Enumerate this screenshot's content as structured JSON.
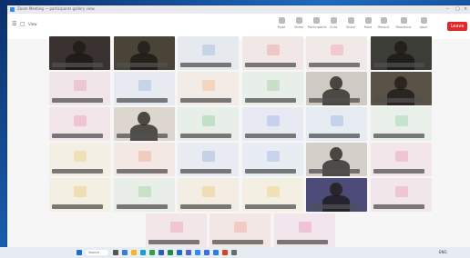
{
  "window": {
    "title": "Zoom Meeting — participants gallery view"
  },
  "toolbar": {
    "left_items": [
      "☰",
      "▢",
      "View"
    ],
    "tools": [
      {
        "label": "Mute",
        "icon": "mic-icon"
      },
      {
        "label": "Video",
        "icon": "camera-icon"
      },
      {
        "label": "Participants",
        "icon": "people-icon"
      },
      {
        "label": "Chat",
        "icon": "chat-icon"
      },
      {
        "label": "Share",
        "icon": "share-icon"
      },
      {
        "label": "More",
        "icon": "more-icon"
      }
    ],
    "right_tools": [
      {
        "label": "Record",
        "icon": "record-icon"
      },
      {
        "label": "Reactions",
        "icon": "reactions-icon"
      },
      {
        "label": "Apps",
        "icon": "apps-icon"
      }
    ],
    "leave_label": "Leave"
  },
  "tiles": [
    {
      "row": 0,
      "col": 0,
      "kind": "photo",
      "bg": "#3a3230",
      "name": "Participant"
    },
    {
      "row": 0,
      "col": 1,
      "kind": "photo",
      "bg": "#4a4438",
      "name": "Participant"
    },
    {
      "row": 0,
      "col": 2,
      "kind": "avatar",
      "bg": "#e6e9ee",
      "av": "#c7d3e6",
      "name": "Participant"
    },
    {
      "row": 0,
      "col": 3,
      "kind": "avatar",
      "bg": "#f2e7e7",
      "av": "#f0c7c7",
      "name": "Participant"
    },
    {
      "row": 0,
      "col": 4,
      "kind": "avatar",
      "bg": "#f1e8e8",
      "av": "#f2c9cf",
      "name": "Participant"
    },
    {
      "row": 0,
      "col": 5,
      "kind": "photo",
      "bg": "#3b3d36",
      "name": "Participant"
    },
    {
      "row": 1,
      "col": 0,
      "kind": "avatar",
      "bg": "#f0e6e9",
      "av": "#eec6d2",
      "name": "Participant"
    },
    {
      "row": 1,
      "col": 1,
      "kind": "avatar",
      "bg": "#e7ebf1",
      "av": "#c6d4ea",
      "name": "Participant"
    },
    {
      "row": 1,
      "col": 2,
      "kind": "avatar",
      "bg": "#f3ece6",
      "av": "#f2d6c0",
      "name": "Participant"
    },
    {
      "row": 1,
      "col": 3,
      "kind": "avatar",
      "bg": "#e8eee8",
      "av": "#c8e0c8",
      "name": "Participant"
    },
    {
      "row": 1,
      "col": 4,
      "kind": "photo",
      "bg": "#cfcac4",
      "name": "Participant"
    },
    {
      "row": 1,
      "col": 5,
      "kind": "photo",
      "bg": "#5a5247",
      "name": "Participant"
    },
    {
      "row": 2,
      "col": 0,
      "kind": "avatar",
      "bg": "#f2e6ea",
      "av": "#f0c3d2",
      "name": "Participant"
    },
    {
      "row": 2,
      "col": 1,
      "kind": "photo",
      "bg": "#ddd6cf",
      "name": "Participant"
    },
    {
      "row": 2,
      "col": 2,
      "kind": "avatar",
      "bg": "#e8efe8",
      "av": "#c2e0c5",
      "name": "Participant"
    },
    {
      "row": 2,
      "col": 3,
      "kind": "avatar",
      "bg": "#e8eaf3",
      "av": "#c9cff0",
      "name": "Participant"
    },
    {
      "row": 2,
      "col": 4,
      "kind": "avatar",
      "bg": "#e7ecf3",
      "av": "#c5d3ea",
      "name": "Participant"
    },
    {
      "row": 2,
      "col": 5,
      "kind": "avatar",
      "bg": "#e9f0ea",
      "av": "#c6e3cb",
      "name": "Participant"
    },
    {
      "row": 3,
      "col": 0,
      "kind": "avatar",
      "bg": "#f3efe4",
      "av": "#efe0b8",
      "name": "Participant"
    },
    {
      "row": 3,
      "col": 1,
      "kind": "avatar",
      "bg": "#f3e8e4",
      "av": "#f1cbbd",
      "name": "Participant"
    },
    {
      "row": 3,
      "col": 2,
      "kind": "avatar",
      "bg": "#e8ebf1",
      "av": "#c7d1e6",
      "name": "Participant"
    },
    {
      "row": 3,
      "col": 3,
      "kind": "avatar",
      "bg": "#e8ecf3",
      "av": "#c8d3ec",
      "name": "Participant"
    },
    {
      "row": 3,
      "col": 4,
      "kind": "photo",
      "bg": "#d4cfc8",
      "name": "Participant"
    },
    {
      "row": 3,
      "col": 5,
      "kind": "avatar",
      "bg": "#f3e6ea",
      "av": "#f1c4d1",
      "name": "Participant"
    },
    {
      "row": 4,
      "col": 0,
      "kind": "avatar",
      "bg": "#f3efe3",
      "av": "#f0deb3",
      "name": "Participant"
    },
    {
      "row": 4,
      "col": 1,
      "kind": "avatar",
      "bg": "#e9efe8",
      "av": "#c7e1c5",
      "name": "Participant"
    },
    {
      "row": 4,
      "col": 2,
      "kind": "avatar",
      "bg": "#f3ede3",
      "av": "#f1dcb6",
      "name": "Participant"
    },
    {
      "row": 4,
      "col": 3,
      "kind": "avatar",
      "bg": "#f3efe3",
      "av": "#f2e1b5",
      "name": "Participant"
    },
    {
      "row": 4,
      "col": 4,
      "kind": "photo",
      "bg": "#4d4c78",
      "name": "Participant"
    },
    {
      "row": 4,
      "col": 5,
      "kind": "avatar",
      "bg": "#f1e6ea",
      "av": "#efc5d3",
      "name": "Participant"
    },
    {
      "row": 5,
      "col": 1.5,
      "kind": "avatar",
      "bg": "#f2e6e9",
      "av": "#f0c6cf",
      "name": "Participant"
    },
    {
      "row": 5,
      "col": 2.5,
      "kind": "avatar",
      "bg": "#f3e7e5",
      "av": "#f1cbc3",
      "name": "Participant"
    },
    {
      "row": 5,
      "col": 3.5,
      "kind": "avatar",
      "bg": "#f2e6ec",
      "av": "#efc3d6",
      "name": "Participant"
    }
  ],
  "taskbar": {
    "search_label": "Search",
    "icons": [
      {
        "name": "windows-start-icon",
        "color": "#1f6fd1"
      },
      {
        "name": "search-icon",
        "color": "#555555"
      },
      {
        "name": "widgets-icon",
        "color": "#3a7bd5"
      },
      {
        "name": "file-explorer-icon",
        "color": "#f2b52b"
      },
      {
        "name": "edge-icon",
        "color": "#1f9bd6"
      },
      {
        "name": "chrome-icon",
        "color": "#2ea34a"
      },
      {
        "name": "word-icon",
        "color": "#2b5fb8"
      },
      {
        "name": "excel-icon",
        "color": "#1e8a4c"
      },
      {
        "name": "outlook-icon",
        "color": "#1671c4"
      },
      {
        "name": "teams-icon",
        "color": "#5a5fc7"
      },
      {
        "name": "zoom-icon",
        "color": "#2d8cff"
      },
      {
        "name": "store-icon",
        "color": "#3f6ee0"
      },
      {
        "name": "mail-icon",
        "color": "#2d7fd6"
      },
      {
        "name": "powerpoint-icon",
        "color": "#d24726"
      },
      {
        "name": "settings-icon",
        "color": "#6b6b6b"
      }
    ],
    "tray_text": "ENG"
  }
}
